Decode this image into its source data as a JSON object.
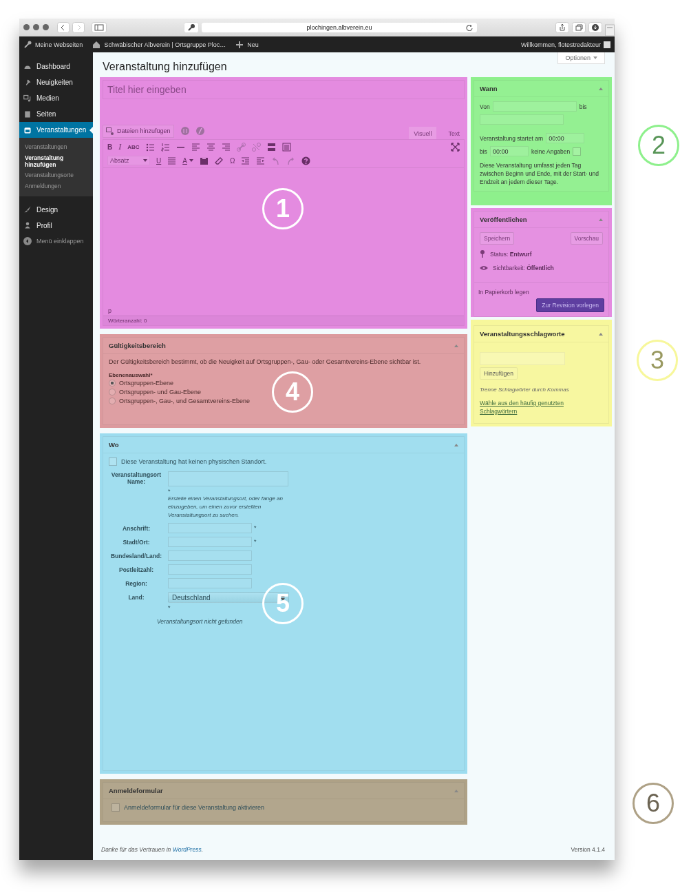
{
  "browser": {
    "url": "plochingen.albverein.eu"
  },
  "admin_bar": {
    "items": [
      "Meine Webseiten",
      "Schwäbischer Albverein | Ortsgruppe Ploc…",
      "Neu"
    ],
    "greeting": "Willkommen, flotestredakteur"
  },
  "sidebar": {
    "items": [
      {
        "label": "Dashboard",
        "selected": false
      },
      {
        "label": "Neuigkeiten",
        "selected": false
      },
      {
        "label": "Medien",
        "selected": false
      },
      {
        "label": "Seiten",
        "selected": false
      },
      {
        "label": "Veranstaltungen",
        "selected": true,
        "children": [
          {
            "label": "Veranstaltungen",
            "selected": false
          },
          {
            "label": "Veranstaltung hinzufügen",
            "selected": true
          },
          {
            "label": "Veranstaltungsorte",
            "selected": false
          },
          {
            "label": "Anmeldungen",
            "selected": false
          }
        ]
      },
      {
        "label": "Design",
        "selected": false
      },
      {
        "label": "Profil",
        "selected": false
      }
    ],
    "collapse": "Menü einklappen"
  },
  "page": {
    "title": "Veranstaltung hinzufügen",
    "options_button": "Optionen"
  },
  "editor": {
    "color": "#e48be0",
    "marker": {
      "text": "1",
      "kind": "inside"
    },
    "title_placeholder": "Titel hier eingeben",
    "media_button": "Dateien hinzufügen",
    "tabs": [
      {
        "label": "Visuell",
        "selected": true
      },
      {
        "label": "Text",
        "selected": false
      }
    ],
    "glyphs": [
      "B",
      "I",
      "ABC",
      "U",
      "A",
      "Ω"
    ],
    "format_select": "Absatz",
    "path": "p",
    "word_count": "Wörteranzahl: 0"
  },
  "scope": {
    "color": "#dc9a9e",
    "marker": {
      "text": "4",
      "kind": "inside"
    },
    "title": "Gültigkeitsbereich",
    "description": "Der Gültigkeitsbereich bestimmt, ob die Neuigkeit auf Ortsgruppen-, Gau- oder Gesamtvereins-Ebene sichtbar ist.",
    "level_label": "Ebenenauswahl*",
    "options": [
      {
        "label": "Ortsgruppen-Ebene",
        "selected": true
      },
      {
        "label": "Ortsgruppen- und Gau-Ebene",
        "selected": false
      },
      {
        "label": "Ortsgruppen-, Gau-, und Gesamtvereins-Ebene",
        "selected": false
      }
    ]
  },
  "where": {
    "color": "#9cdcef",
    "marker": {
      "text": "5",
      "kind": "inside"
    },
    "title": "Wo",
    "no_location": {
      "label": "Diese Veranstaltung hat keinen physischen Standort.",
      "checked": false
    },
    "name_label": "Veranstaltungsort Name:",
    "name_required": "*",
    "name_hint": "Erstelle einen Veranstaltungsort, oder fange an einzugeben, um einen zuvor erstellten Veranstaltungsort zu suchen.",
    "fields": [
      {
        "label": "Anschrift:",
        "required": "*"
      },
      {
        "label": "Stadt/Ort:",
        "required": "*"
      },
      {
        "label": "Bundesland/Land:"
      },
      {
        "label": "Postleitzahl:"
      },
      {
        "label": "Region:"
      }
    ],
    "country_label": "Land:",
    "country": "Deutschland",
    "country_required": "*",
    "not_found": "Veranstaltungsort nicht gefunden"
  },
  "registration": {
    "color": "#aea186",
    "marker": {
      "text": "6",
      "kind": "outside"
    },
    "title": "Anmeldeformular",
    "checkbox": {
      "label": "Anmeldeformular für diese Veranstaltung aktivieren",
      "checked": false
    }
  },
  "when": {
    "color": "#8ef08c",
    "marker": {
      "text": "2",
      "kind": "outside"
    },
    "title": "Wann",
    "from_label": "Von",
    "to_label": "bis",
    "start_label": "Veranstaltung startet am",
    "start_time": "00:00",
    "end_label": "bis",
    "end_time": "00:00",
    "no_info_label": "keine Angaben",
    "no_info_checked": false,
    "note": "Diese Veranstaltung umfasst jeden Tag zwischen Beginn und Ende, mit der Start- und Endzeit an jedem dieser Tage."
  },
  "publish": {
    "color": "#e48be0",
    "title": "Veröffentlichen",
    "save": "Speichern",
    "preview": "Vorschau",
    "status": "Status: **Entwurf**",
    "visibility": "Sichtbarkeit: **Öffentlich**",
    "trash": "In Papierkorb legen",
    "submit": "Zur Revision vorlegen"
  },
  "tags": {
    "color": "#f7f79b",
    "marker": {
      "text": "3",
      "kind": "outside"
    },
    "title": "Veranstaltungsschlagworte",
    "add": "Hinzufügen",
    "hint": "Trenne Schlagwörter durch Kommas",
    "link": "Wähle aus den häufig genutzten Schlagwörtern"
  },
  "footer": {
    "thanks": "Danke für das Vertrauen in",
    "link": "WordPress",
    "after": ".",
    "version": "Version 4.1.4"
  }
}
